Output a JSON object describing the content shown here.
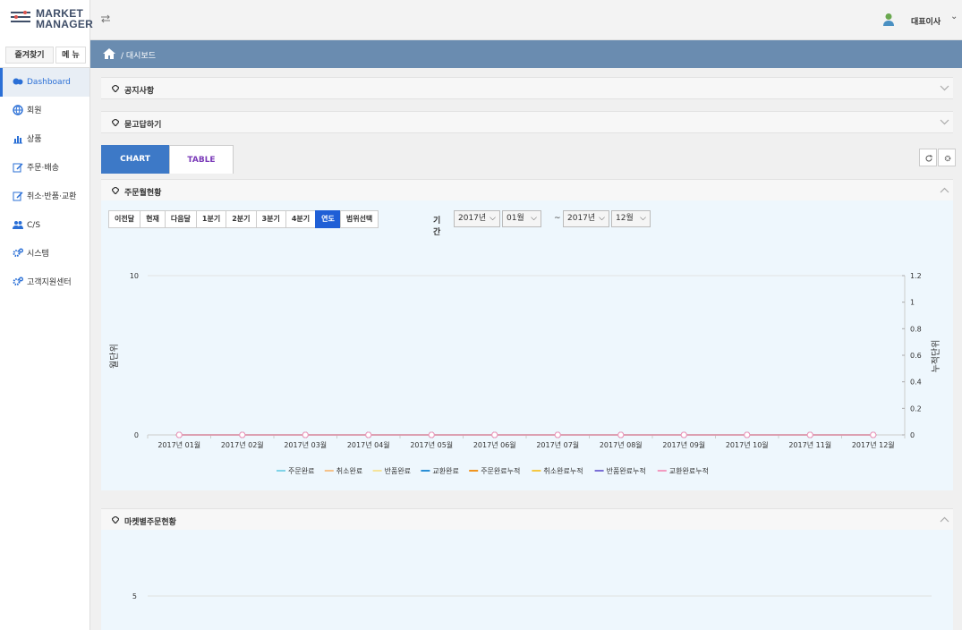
{
  "app": {
    "logo_line1": "MARKET",
    "logo_line2": "MANAGER"
  },
  "header": {
    "user_name": "대표이사",
    "caret": "⌄"
  },
  "sidebar": {
    "tabs": [
      {
        "label": "즐겨찾기"
      },
      {
        "label": "메 뉴"
      }
    ],
    "items": [
      {
        "label": "Dashboard",
        "icon": "dashboard-icon",
        "active": true
      },
      {
        "label": "회원",
        "icon": "globe-icon"
      },
      {
        "label": "상품",
        "icon": "bar-chart-icon"
      },
      {
        "label": "주문·배송",
        "icon": "edit-icon"
      },
      {
        "label": "취소·반품·교환",
        "icon": "edit-icon"
      },
      {
        "label": "C/S",
        "icon": "users-icon"
      },
      {
        "label": "시스템",
        "icon": "cogs-icon"
      },
      {
        "label": "고객지원센터",
        "icon": "cogs-icon"
      }
    ]
  },
  "breadcrumb": {
    "text": "/ 대시보드"
  },
  "panels": {
    "notice": "공지사항",
    "qna": "묻고답하기",
    "monthly": "주문월현황",
    "market": "마켓별주문현황"
  },
  "view_tabs": {
    "chart": "CHART",
    "table": "TABLE"
  },
  "filters": {
    "buttons": [
      "이전달",
      "현재",
      "다음달",
      "1분기",
      "2분기",
      "3분기",
      "4분기",
      "연도",
      "범위선택"
    ],
    "active": "연도",
    "period_label": "기간",
    "from_year": "2017년",
    "from_month": "01월",
    "separator": "~",
    "to_year": "2017년",
    "to_month": "12월"
  },
  "colors": {
    "accent": "#3d79c7",
    "breadcrumb_bg": "#6a8cb0",
    "active_filter": "#1f5fd6"
  },
  "chart_data": [
    {
      "type": "line",
      "categories": [
        "2017년 01월",
        "2017년 02월",
        "2017년 03월",
        "2017년 04월",
        "2017년 05월",
        "2017년 06월",
        "2017년 07월",
        "2017년 08월",
        "2017년 09월",
        "2017년 10월",
        "2017년 11월",
        "2017년 12월"
      ],
      "ylabel": "월단위",
      "y2label": "누적단위",
      "ylim": [
        0,
        10
      ],
      "y_ticks": [
        "0",
        "10"
      ],
      "y2lim": [
        0,
        1.2
      ],
      "y2_ticks": [
        "0",
        "0.2",
        "0.4",
        "0.6",
        "0.8",
        "1",
        "1.2"
      ],
      "legend_position": "bottom",
      "series": [
        {
          "name": "주문완료",
          "color": "#7fd3e8",
          "values": [
            0,
            0,
            0,
            0,
            0,
            0,
            0,
            0,
            0,
            0,
            0,
            0
          ]
        },
        {
          "name": "취소완료",
          "color": "#f5c28a",
          "values": [
            0,
            0,
            0,
            0,
            0,
            0,
            0,
            0,
            0,
            0,
            0,
            0
          ]
        },
        {
          "name": "반품완료",
          "color": "#f5e39a",
          "values": [
            0,
            0,
            0,
            0,
            0,
            0,
            0,
            0,
            0,
            0,
            0,
            0
          ]
        },
        {
          "name": "교환완료",
          "color": "#2a8fd6",
          "values": [
            0,
            0,
            0,
            0,
            0,
            0,
            0,
            0,
            0,
            0,
            0,
            0
          ]
        },
        {
          "name": "주문완료누적",
          "color": "#f0941f",
          "values": [
            0,
            0,
            0,
            0,
            0,
            0,
            0,
            0,
            0,
            0,
            0,
            0
          ]
        },
        {
          "name": "취소완료누적",
          "color": "#f5c842",
          "values": [
            0,
            0,
            0,
            0,
            0,
            0,
            0,
            0,
            0,
            0,
            0,
            0
          ]
        },
        {
          "name": "반품완료누적",
          "color": "#7a6fd6",
          "values": [
            0,
            0,
            0,
            0,
            0,
            0,
            0,
            0,
            0,
            0,
            0,
            0
          ]
        },
        {
          "name": "교환완료누적",
          "color": "#f29ac0",
          "values": [
            0,
            0,
            0,
            0,
            0,
            0,
            0,
            0,
            0,
            0,
            0,
            0
          ]
        }
      ]
    },
    {
      "type": "bar",
      "y_ticks": [
        "5"
      ],
      "ylim": [
        0,
        5
      ]
    }
  ]
}
